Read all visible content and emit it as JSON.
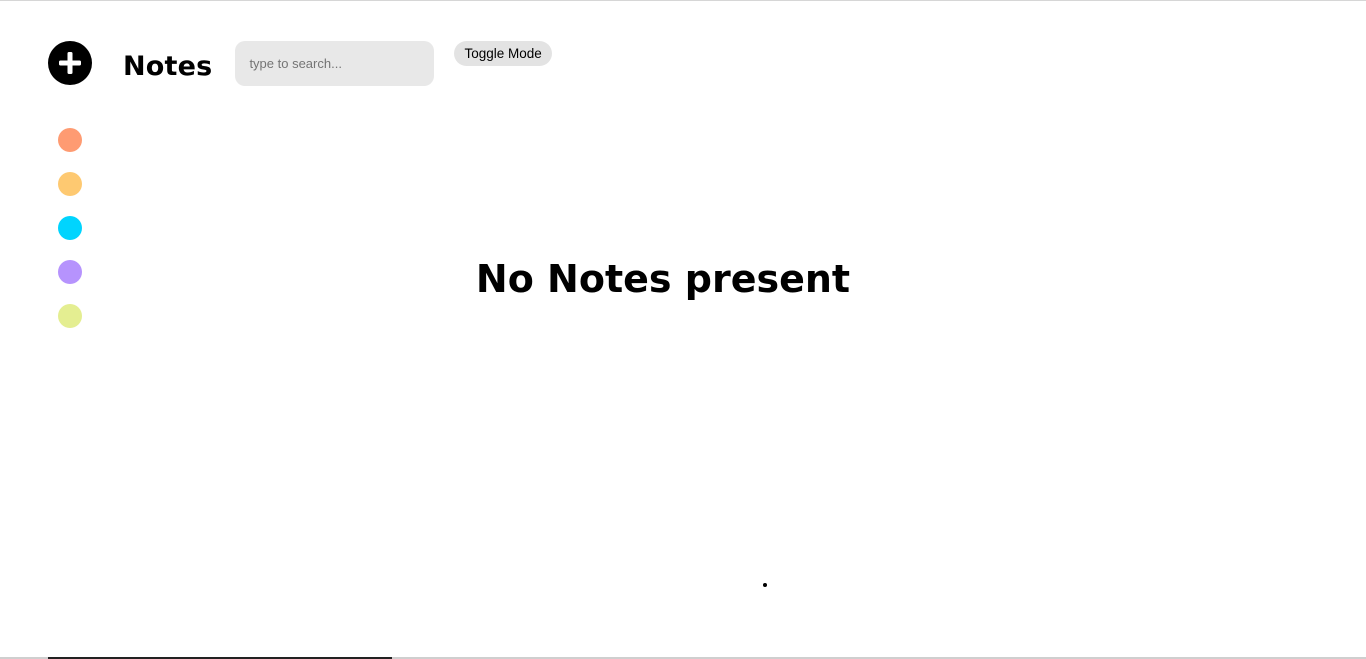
{
  "header": {
    "title": "Notes",
    "search": {
      "placeholder": "type to search...",
      "value": ""
    },
    "toggle_label": "Toggle Mode"
  },
  "sidebar": {
    "add_icon": "plus-circle-icon",
    "colors": [
      "#fe9b72",
      "#fec971",
      "#00d4fe",
      "#b693fd",
      "#e4ee91"
    ]
  },
  "main": {
    "empty_message": "No Notes present"
  }
}
